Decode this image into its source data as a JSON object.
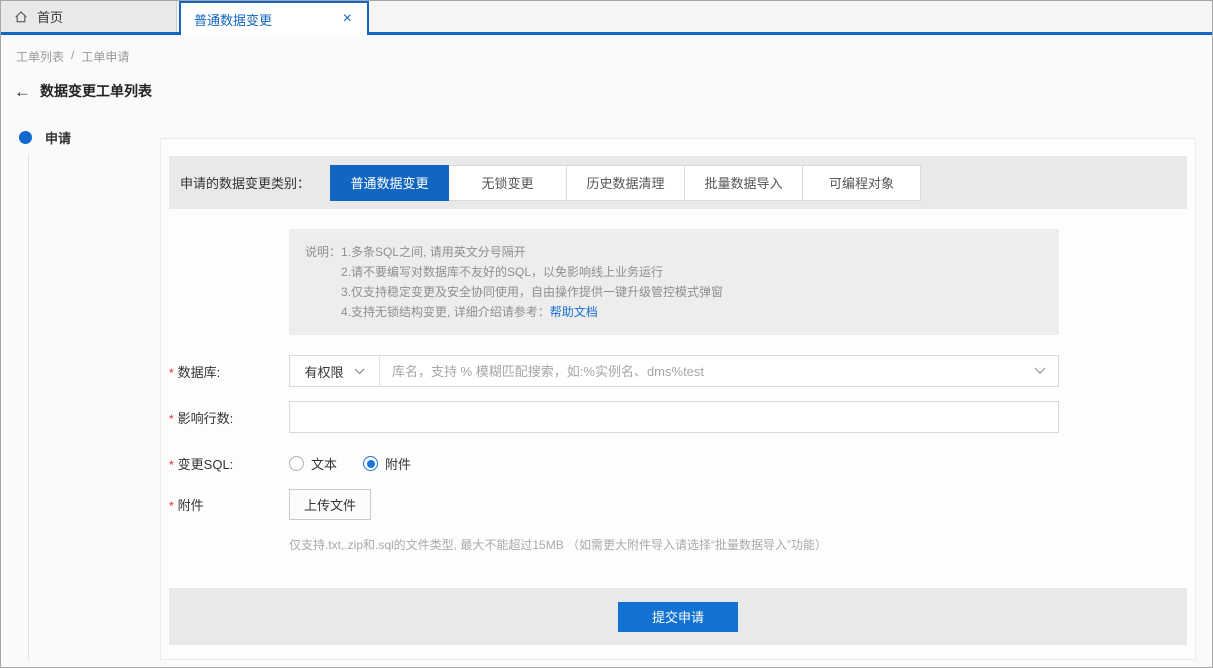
{
  "tabs": {
    "home": {
      "label": "首页"
    },
    "active": {
      "label": "普通数据变更"
    }
  },
  "breadcrumb": {
    "items": [
      "工单列表",
      "工单申请"
    ],
    "separator": "/"
  },
  "page": {
    "title": "数据变更工单列表"
  },
  "steps": {
    "current": "申请"
  },
  "form": {
    "category": {
      "label": "申请的数据变更类别：",
      "options": [
        {
          "label": "普通数据变更",
          "active": true
        },
        {
          "label": "无锁变更",
          "active": false
        },
        {
          "label": "历史数据清理",
          "active": false
        },
        {
          "label": "批量数据导入",
          "active": false
        },
        {
          "label": "可编程对象",
          "active": false
        }
      ]
    },
    "notes": {
      "label": "说明：",
      "lines": [
        "1.多条SQL之间, 请用英文分号隔开",
        "2.请不要编写对数据库不友好的SQL，以免影响线上业务运行",
        "3.仅支持稳定变更及安全协同使用，自由操作提供一键升级管控模式弹窗",
        "4.支持无锁结构变更, 详细介绍请参考："
      ],
      "help_link": "帮助文档"
    },
    "fields": {
      "database": {
        "required_mark": "*",
        "label": "数据库:",
        "scope_value": "有权限",
        "placeholder": "库名，支持 % 模糊匹配搜索，如:%实例名、dms%test",
        "value": ""
      },
      "affected_rows": {
        "required_mark": "*",
        "label": "影响行数:",
        "value": ""
      },
      "change_sql": {
        "required_mark": "*",
        "label": "变更SQL:",
        "options": [
          {
            "label": "文本",
            "checked": false
          },
          {
            "label": "附件",
            "checked": true
          }
        ]
      },
      "attachment": {
        "required_mark": "*",
        "label": "附件",
        "upload_button": "上传文件",
        "hint": "仅支持.txt,.zip和.sql的文件类型, 最大不能超过15MB （如需更大附件导入请选择“批量数据导入”功能）"
      }
    },
    "submit": {
      "label": "提交申请"
    }
  },
  "colors": {
    "accent_blue": "#1265c0",
    "tab_border_blue": "#1366c1",
    "submit_blue": "#1272d2",
    "link_blue": "#1a6fd4",
    "radio_blue": "#1a79d9",
    "required_red": "#e02c2c",
    "strip_gray": "#e9e9e9",
    "note_gray": "#ededed"
  }
}
